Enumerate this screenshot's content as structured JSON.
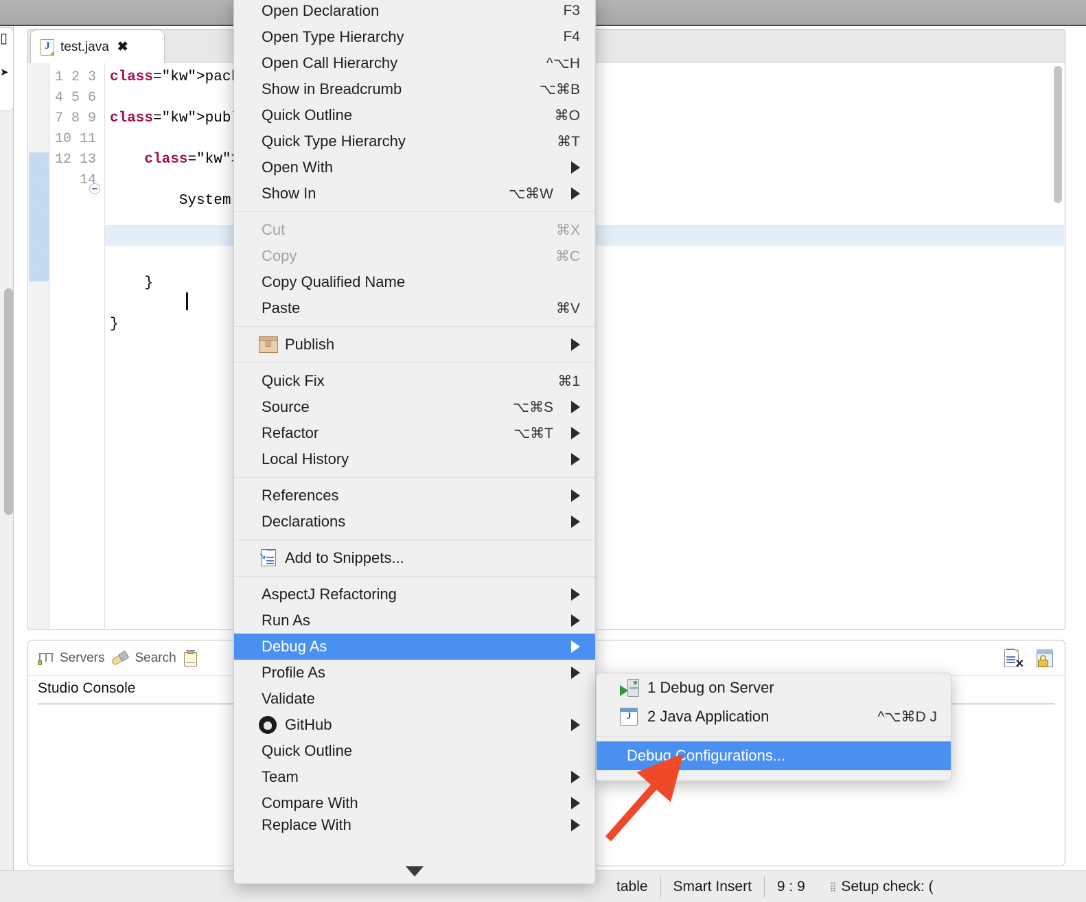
{
  "app": {
    "colors": {
      "menu_background": "#EFF0EF",
      "menu_highlight": "#4A90F0",
      "annotation_arrow": "#F0492A",
      "current_line": "#E3EEFB",
      "keyword": "#A01050",
      "field": "#2A4FD6"
    }
  },
  "editor": {
    "tab": {
      "label": "test.java",
      "icon": "java-file-icon",
      "close_glyph": "✖"
    },
    "line_numbers": [
      "1",
      "2",
      "3",
      "4",
      "5",
      "6",
      "7",
      "8",
      "9",
      "10",
      "11",
      "12",
      "13",
      "14"
    ],
    "code_lines": [
      {
        "n": 1,
        "text": "package com.fusi"
      },
      {
        "n": 2,
        "text": ""
      },
      {
        "n": 3,
        "text": "public class tes"
      },
      {
        "n": 4,
        "text": ""
      },
      {
        "n": 5,
        "text": "    public stati"
      },
      {
        "n": 6,
        "text": ""
      },
      {
        "n": 7,
        "text": "        System.o"
      },
      {
        "n": 8,
        "text": ""
      },
      {
        "n": 9,
        "text": ""
      },
      {
        "n": 10,
        "text": ""
      },
      {
        "n": 11,
        "text": "    }"
      },
      {
        "n": 12,
        "text": ""
      },
      {
        "n": 13,
        "text": "}"
      },
      {
        "n": 14,
        "text": ""
      }
    ]
  },
  "console": {
    "tabs": [
      {
        "label": "Servers",
        "icon": "servers-icon"
      },
      {
        "label": "Search",
        "icon": "search-pin-icon"
      },
      {
        "label": "",
        "icon": "clipboard-icon"
      }
    ],
    "title": "Studio Console",
    "toolbar": [
      {
        "icon": "clear-console-icon"
      },
      {
        "icon": "lock-scroll-icon"
      }
    ]
  },
  "statusbar": {
    "writable": "table",
    "insert_mode": "Smart Insert",
    "cursor_position": "9 : 9",
    "setup_check": "Setup check: ("
  },
  "context_menu": {
    "groups": [
      {
        "items": [
          {
            "label": "Open Declaration",
            "accel": "F3"
          },
          {
            "label": "Open Type Hierarchy",
            "accel": "F4"
          },
          {
            "label": "Open Call Hierarchy",
            "accel": "^⌥H"
          },
          {
            "label": "Show in Breadcrumb",
            "accel": "⌥⌘B"
          },
          {
            "label": "Quick Outline",
            "accel": "⌘O"
          },
          {
            "label": "Quick Type Hierarchy",
            "accel": "⌘T"
          },
          {
            "label": "Open With",
            "accel": "",
            "submenu": true
          },
          {
            "label": "Show In",
            "accel": "⌥⌘W",
            "submenu": true
          }
        ]
      },
      {
        "items": [
          {
            "label": "Cut",
            "accel": "⌘X",
            "disabled": true
          },
          {
            "label": "Copy",
            "accel": "⌘C",
            "disabled": true
          },
          {
            "label": "Copy Qualified Name",
            "accel": ""
          },
          {
            "label": "Paste",
            "accel": "⌘V"
          }
        ]
      },
      {
        "items": [
          {
            "label": "Publish",
            "accel": "",
            "submenu": true,
            "icon": "package-box-icon"
          }
        ]
      },
      {
        "items": [
          {
            "label": "Quick Fix",
            "accel": "⌘1"
          },
          {
            "label": "Source",
            "accel": "⌥⌘S",
            "submenu": true
          },
          {
            "label": "Refactor",
            "accel": "⌥⌘T",
            "submenu": true
          },
          {
            "label": "Local History",
            "accel": "",
            "submenu": true
          }
        ]
      },
      {
        "items": [
          {
            "label": "References",
            "accel": "",
            "submenu": true
          },
          {
            "label": "Declarations",
            "accel": "",
            "submenu": true
          }
        ]
      },
      {
        "items": [
          {
            "label": "Add to Snippets...",
            "accel": "",
            "icon": "snippets-icon"
          }
        ]
      },
      {
        "items": [
          {
            "label": "AspectJ Refactoring",
            "accel": "",
            "submenu": true
          },
          {
            "label": "Run As",
            "accel": "",
            "submenu": true
          },
          {
            "label": "Debug As",
            "accel": "",
            "submenu": true,
            "selected": true
          },
          {
            "label": "Profile As",
            "accel": "",
            "submenu": true
          },
          {
            "label": "Validate",
            "accel": ""
          },
          {
            "label": "GitHub",
            "accel": "",
            "submenu": true,
            "icon": "github-icon"
          },
          {
            "label": "Quick Outline",
            "accel": ""
          },
          {
            "label": "Team",
            "accel": "",
            "submenu": true
          },
          {
            "label": "Compare With",
            "accel": "",
            "submenu": true
          },
          {
            "label": "Replace With",
            "accel": "",
            "submenu": true,
            "clipped": true
          }
        ]
      }
    ],
    "scroll_down_indicator": "▼"
  },
  "submenu": {
    "items": [
      {
        "label": "1 Debug on Server",
        "accel": "",
        "icon": "debug-on-server-icon"
      },
      {
        "label": "2 Java Application",
        "accel": "^⌥⌘D J",
        "icon": "java-application-icon"
      }
    ],
    "footer": {
      "label": "Debug Configurations...",
      "selected": true
    }
  },
  "annotation": {
    "arrow": {
      "name": "red-pointer-arrow",
      "target": "Debug Configurations..."
    }
  }
}
